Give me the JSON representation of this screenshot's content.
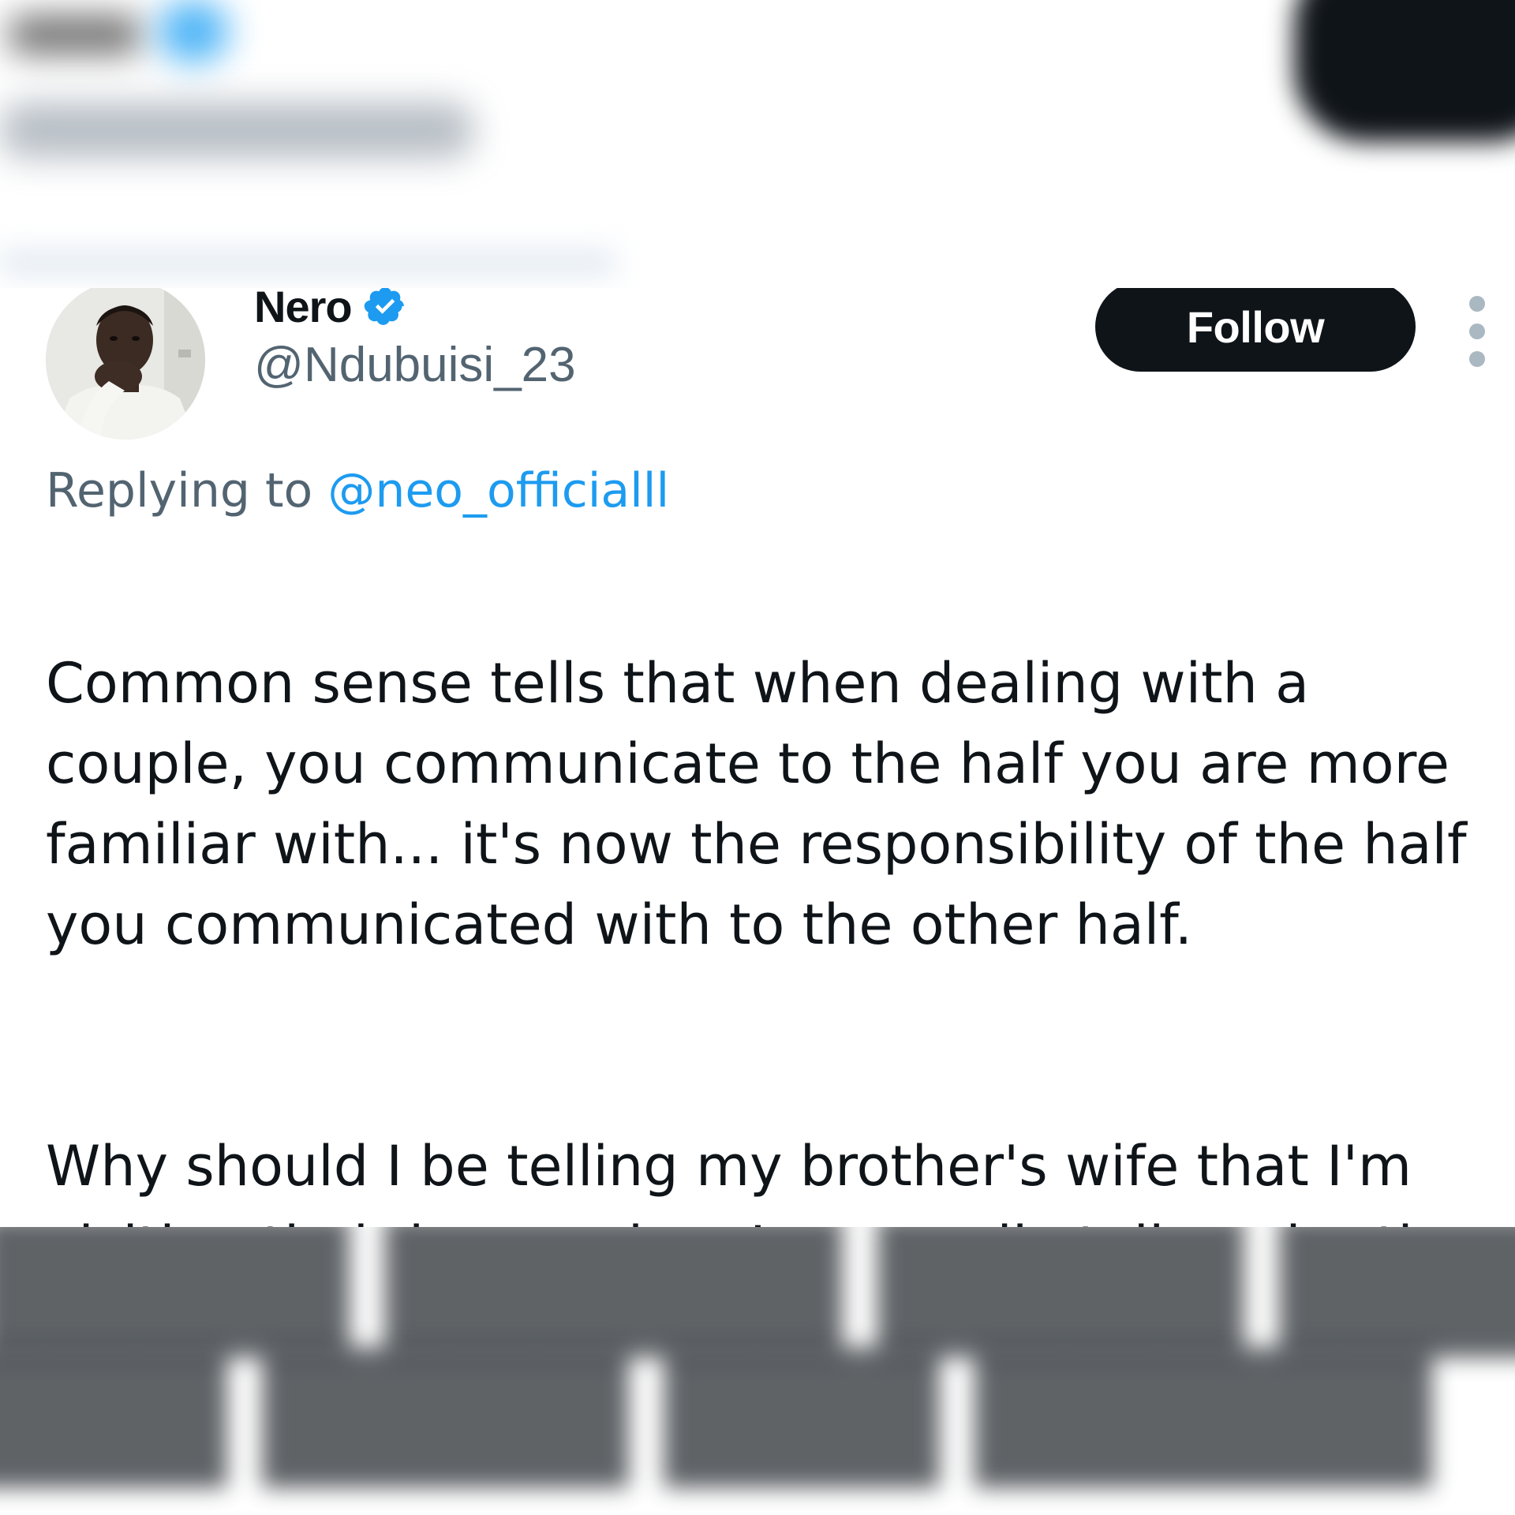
{
  "tweet": {
    "display_name": "Nero",
    "verified_icon": "verified-badge-icon",
    "handle": "@Ndubuisi_23",
    "follow_label": "Follow",
    "more_icon": "more-options-icon",
    "reply_prefix": "Replying to",
    "reply_to": "@neo_officialll",
    "body_paragraphs": [
      "Common sense tells that when dealing with a couple, you communicate to the half you are more familiar with... it's now the responsibility of the half you communicated with to the other half.",
      "Why should I be telling my brother's wife that I'm visiting their home when I can easily tell my brother and he will tell his wife."
    ]
  },
  "colors": {
    "text_primary": "#0f1419",
    "text_secondary": "#536471",
    "accent": "#1d9bf0",
    "button_bg": "#0f1419",
    "button_text": "#ffffff"
  }
}
